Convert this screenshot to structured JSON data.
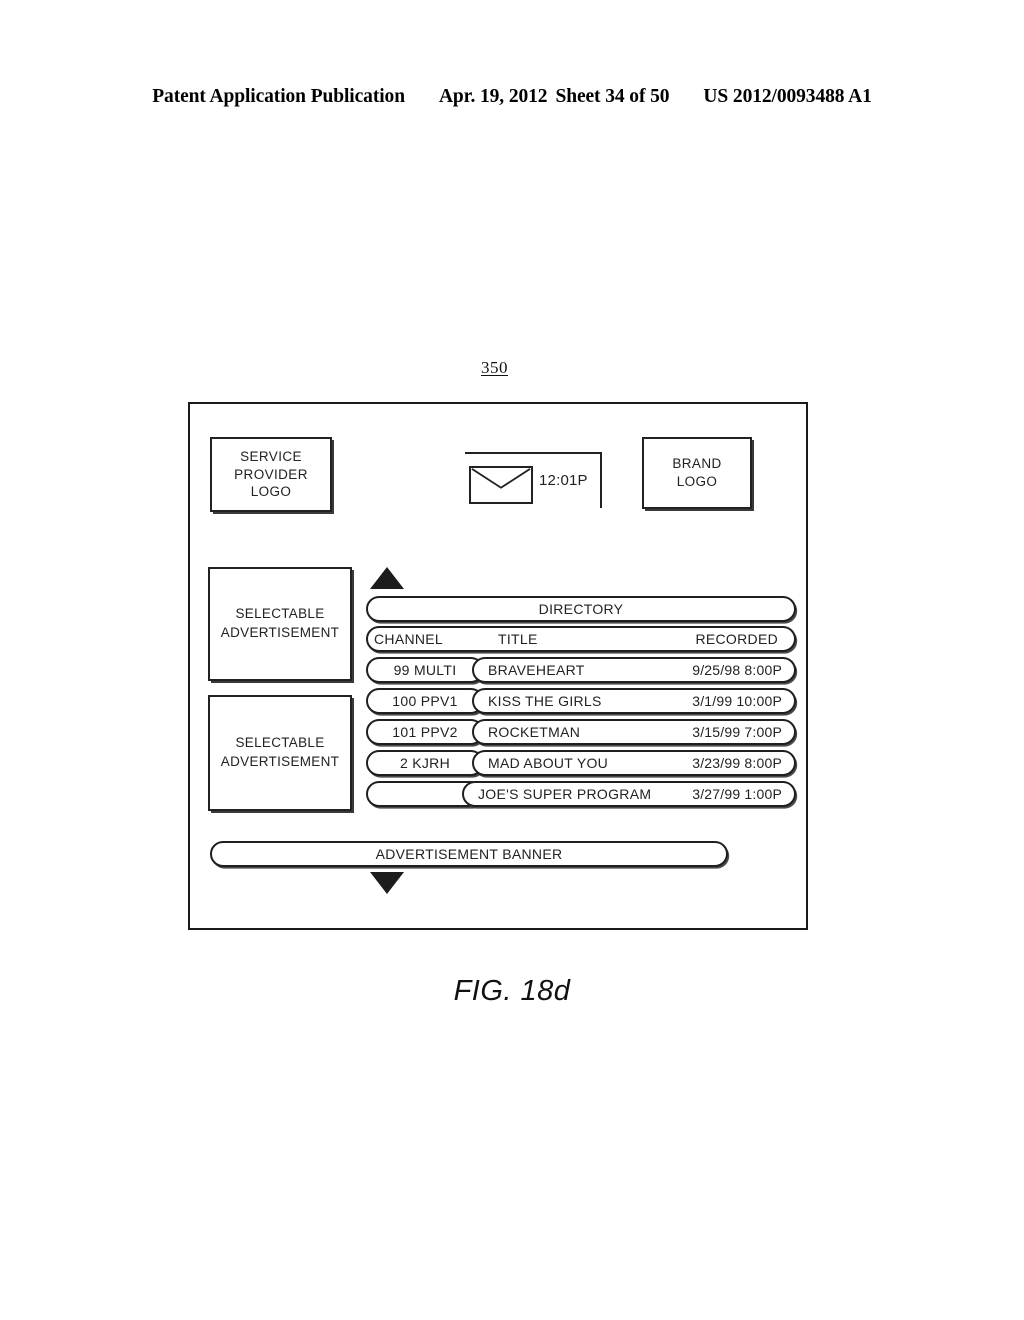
{
  "publication_header": {
    "title": "Patent Application Publication",
    "date": "Apr. 19, 2012",
    "sheet": "Sheet 34 of 50",
    "number": "US 2012/0093488 A1"
  },
  "figure": {
    "reference_numeral": "350",
    "caption": "FIG. 18d"
  },
  "screen": {
    "service_provider_logo": {
      "line1": "SERVICE",
      "line2": "PROVIDER",
      "line3": "LOGO"
    },
    "brand_logo": {
      "line1": "BRAND",
      "line2": "LOGO"
    },
    "status_bar": {
      "mail_icon": "envelope-icon",
      "time": "12:01P"
    },
    "advertisements": [
      {
        "line1": "SELECTABLE",
        "line2": "ADVERTISEMENT"
      },
      {
        "line1": "SELECTABLE",
        "line2": "ADVERTISEMENT"
      }
    ],
    "scroll_up_icon": "triangle-up-icon",
    "scroll_down_icon": "triangle-down-icon",
    "directory": {
      "title": "DIRECTORY",
      "columns": {
        "channel": "CHANNEL",
        "title": "TITLE",
        "recorded": "RECORDED"
      },
      "rows": [
        {
          "channel": "99 MULTI",
          "title": "BRAVEHEART",
          "recorded": "9/25/98  8:00P"
        },
        {
          "channel": "100 PPV1",
          "title": "KISS THE GIRLS",
          "recorded": "3/1/99  10:00P"
        },
        {
          "channel": "101 PPV2",
          "title": "ROCKETMAN",
          "recorded": "3/15/99  7:00P"
        },
        {
          "channel": "2 KJRH",
          "title": "MAD ABOUT YOU",
          "recorded": "3/23/99  8:00P"
        },
        {
          "channel": "",
          "title": "JOE'S SUPER PROGRAM",
          "recorded": "3/27/99  1:00P"
        }
      ]
    },
    "advertisement_banner": "ADVERTISEMENT BANNER"
  }
}
